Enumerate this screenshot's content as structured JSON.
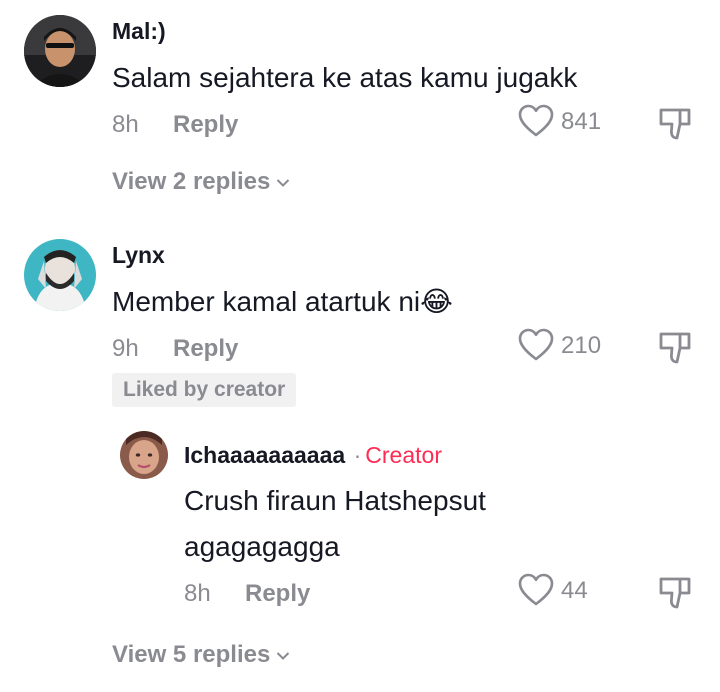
{
  "comments": [
    {
      "username": "Mal:)",
      "text": "Salam sejahtera ke atas kamu jugakk",
      "time": "8h",
      "reply_label": "Reply",
      "likes": "841",
      "view_replies": "View 2 replies"
    },
    {
      "username": "Lynx",
      "text": "Member kamal atartuk ni",
      "emoji": "😂",
      "time": "9h",
      "reply_label": "Reply",
      "likes": "210",
      "liked_by_creator": "Liked by creator",
      "view_replies": "View 5 replies"
    }
  ],
  "reply": {
    "username": "Ichaaaaaaaaaa",
    "separator": "·",
    "creator_tag": "Creator",
    "text_line1": "Crush firaun Hatshepsut",
    "text_line2": "agagagagga",
    "time": "8h",
    "reply_label": "Reply",
    "likes": "44"
  },
  "colors": {
    "text": "#161823",
    "muted": "#8a8b91",
    "creator": "#fe2c55",
    "badge_bg": "#f1f1f2"
  }
}
